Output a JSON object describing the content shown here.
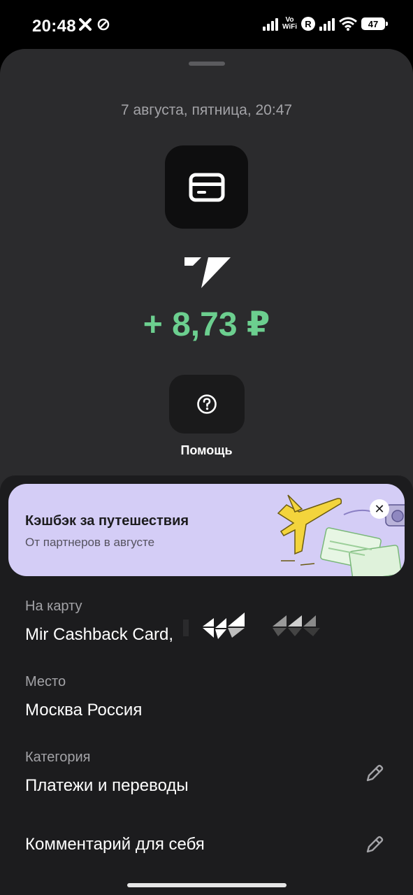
{
  "status_bar": {
    "time": "20:48",
    "vowifi": "Vo WiFi",
    "r_badge": "R",
    "battery": "47",
    "icons": [
      "x-icon",
      "no-disturb-icon",
      "signal-icon",
      "vowifi-icon",
      "roaming-icon",
      "signal-icon",
      "wifi-icon",
      "battery-icon"
    ]
  },
  "transaction": {
    "datetime": "7 августа, пятница, 20:47",
    "category_icon": "credit-card-icon",
    "merchant_logo": "merchant-logo",
    "amount": "+ 8,73 ₽",
    "amount_color": "#6ccf8f",
    "help_icon": "question-circle-icon",
    "help_label": "Помощь"
  },
  "promo": {
    "title": "Кэшбэк за путешествия",
    "subtitle": "От партнеров в августе",
    "background": "#d4cdf6",
    "close_icon": "close-icon"
  },
  "details": {
    "card_label": "На карту",
    "card_value": "Mir Cashback Card,",
    "place_label": "Место",
    "place_value": "Москва Россия",
    "category_label": "Категория",
    "category_value": "Платежи и переводы",
    "comment_label": "Комментарий для себя",
    "edit_icon": "pencil-icon"
  }
}
